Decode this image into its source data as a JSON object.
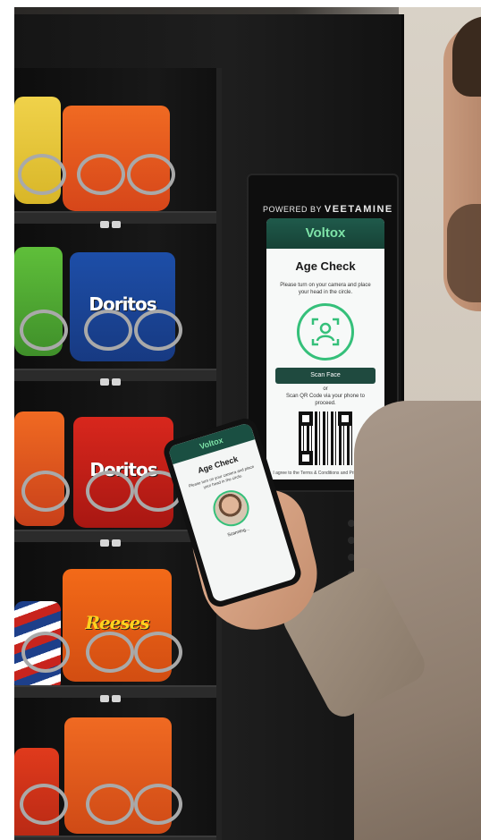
{
  "kiosk": {
    "powered_by_prefix": "POWERED BY",
    "powered_by_brand": "VEETAMINE",
    "logo_text": "Voltox",
    "title": "Age Check",
    "instructions": "Please turn on your camera and place your head in the circle.",
    "scan_button": "Scan Face",
    "or_text": "or",
    "qr_instructions": "Scan QR Code via your phone to proceed.",
    "terms": "I agree to the Terms & Conditions and Privacy Policy.",
    "icons": [
      "face-scan-icon",
      "qr-code-icon"
    ]
  },
  "phone": {
    "logo_text": "Voltox",
    "title": "Age Check",
    "instructions": "Please turn on your camera and place your head in the circle.",
    "status": "Scanning..."
  },
  "products": {
    "doritos_top": "Doritos",
    "doritos_mid": "Doritos",
    "reeses": "Reeses"
  },
  "colors": {
    "brand_dark": "#1f4a3f",
    "brand_accent": "#35c07a",
    "logo_green": "#7ee3a8"
  }
}
